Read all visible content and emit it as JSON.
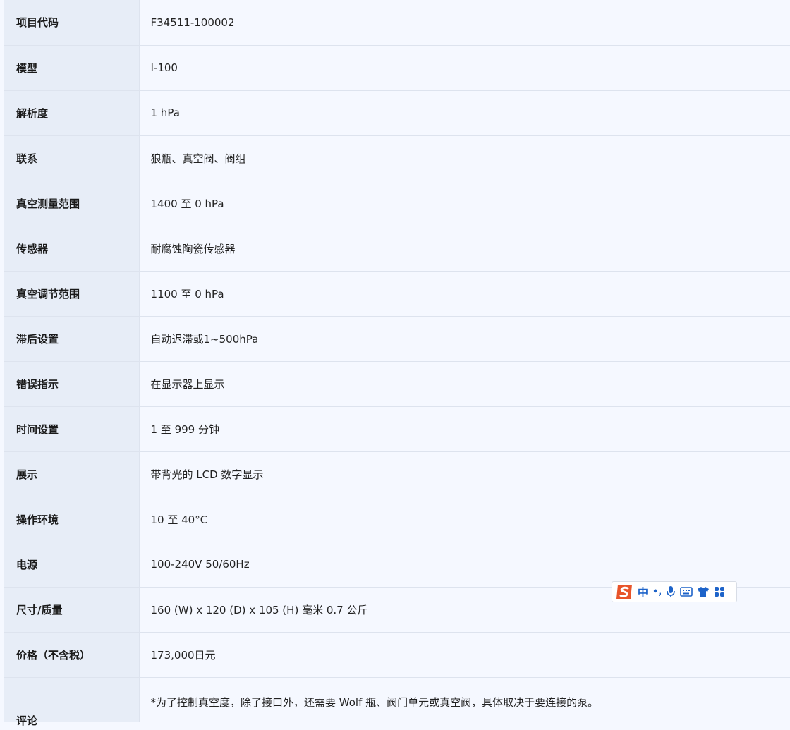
{
  "specs": [
    {
      "label": "项目代码",
      "value": "F34511-100002"
    },
    {
      "label": "模型",
      "value": "I-100"
    },
    {
      "label": "解析度",
      "value": "1 hPa"
    },
    {
      "label": "联系",
      "value": "狼瓶、真空阀、阀组"
    },
    {
      "label": "真空测量范围",
      "value": "1400 至 0 hPa"
    },
    {
      "label": "传感器",
      "value": "耐腐蚀陶瓷传感器"
    },
    {
      "label": "真空调节范围",
      "value": "1100 至 0 hPa"
    },
    {
      "label": "滞后设置",
      "value": "自动迟滞或1~500hPa"
    },
    {
      "label": "错误指示",
      "value": "在显示器上显示"
    },
    {
      "label": "时间设置",
      "value": "1 至 999 分钟"
    },
    {
      "label": "展示",
      "value": "带背光的 LCD 数字显示"
    },
    {
      "label": "操作环境",
      "value": "10 至 40°C"
    },
    {
      "label": "电源",
      "value": "100-240V 50/60Hz"
    },
    {
      "label": "尺寸/质量",
      "value": "160 (W) x 120 (D) x 105 (H) 毫米 0.7 公斤"
    },
    {
      "label": "价格（不含税）",
      "value": "173,000日元"
    },
    {
      "label": "评论",
      "value": "*为了控制真空度，除了接口外，还需要 Wolf 瓶、阀门单元或真空阀，具体取决于要连接的泵。"
    }
  ],
  "ime_toolbar": {
    "mode_label": "中",
    "punct_label": "•,",
    "icons": [
      "sogou-logo-icon",
      "microphone-icon",
      "keyboard-icon",
      "shirt-skin-icon",
      "toolbox-grid-icon"
    ],
    "brand_color": "#e8542a",
    "icon_color": "#1d63c9"
  }
}
